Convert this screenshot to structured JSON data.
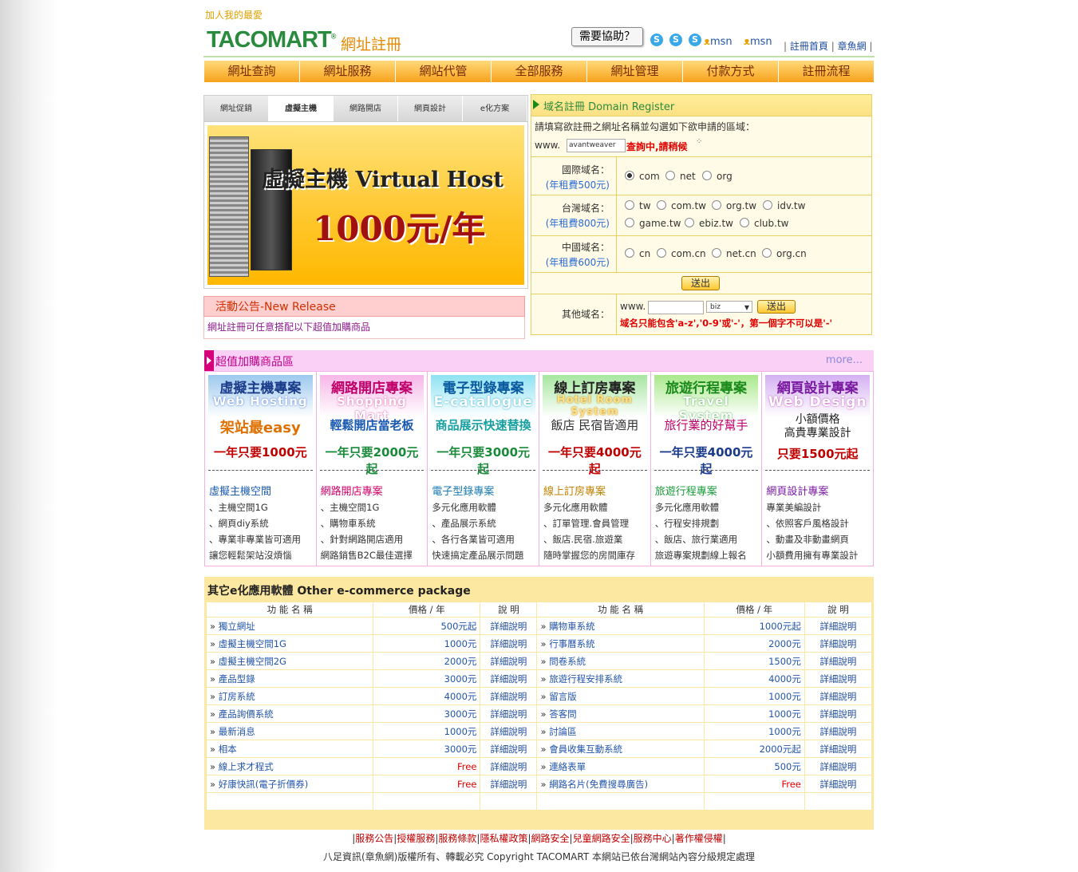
{
  "header": {
    "favorite": "加人我的最愛",
    "logo": "TACOMART",
    "logo_mark": "®",
    "subtitle": "網址註冊",
    "help": "需要協助？",
    "skype_icons": [
      "skype-icon",
      "skype-icon",
      "skype-icon"
    ],
    "msn": "msn",
    "links": [
      "註冊首頁",
      "章魚網"
    ]
  },
  "nav": [
    "網址查詢",
    "網址服務",
    "網站代管",
    "全部服務",
    "網址管理",
    "付款方式",
    "註冊流程"
  ],
  "tabs": [
    "網址促銷",
    "虛擬主機",
    "網路開店",
    "網頁設計",
    "e化方案"
  ],
  "banner": {
    "title": "虛擬主機 Virtual Host",
    "price": "1000元/年"
  },
  "news": {
    "title": "活動公告-New Release",
    "body": "網址註冊可任意搭配以下超值加購商品"
  },
  "domain": {
    "title": "域名註冊 Domain Register",
    "instruction": "請填寫欲註冊之網址名稱並勾選如下欲申請的區域：",
    "www": "www.",
    "value": "avantweaver",
    "status": "查詢中,請稍候",
    "groups": [
      {
        "label": "國際域名：",
        "price": "(年租費500元)",
        "options": [
          "com",
          "net",
          "org"
        ]
      },
      {
        "label": "台灣域名：",
        "price": "(年租費800元)",
        "options": [
          "tw",
          "com.tw",
          "org.tw",
          "idv.tw",
          "game.tw",
          "ebiz.tw",
          "club.tw"
        ]
      },
      {
        "label": "中國域名：",
        "price": "(年租費600元)",
        "options": [
          "cn",
          "com.cn",
          "net.cn",
          "org.cn"
        ]
      }
    ],
    "submit": "送出",
    "other_label": "其他域名：",
    "other_www": "www.",
    "other_select": "biz",
    "other_submit": "送出",
    "rule": "域名只能包含'a-z','0-9'或'-'，第一個字不可以是'-'"
  },
  "valueadd": {
    "title": "超值加購商品區",
    "more": "more...",
    "cols": [
      {
        "a": "虛擬主機專案",
        "b": "Web Hosting",
        "c": "架站最easy",
        "d": "一年只要1000元",
        "title": "虛擬主機空間",
        "items": [
          "、主機空間1G",
          "、網頁diy系統",
          "、專業非專業皆可適用",
          "讓您輕鬆架站沒煩惱"
        ]
      },
      {
        "a": "網路開店專案",
        "b": "Shopping Mart",
        "c": "輕鬆開店當老板",
        "d": "一年只要2000元起",
        "title": "網路開店專案",
        "items": [
          "、主機空間1G",
          "、購物車系統",
          "、針對網路開店適用",
          "網路銷售B2C最佳選擇"
        ]
      },
      {
        "a": "電子型錄專案",
        "b": "E-catalogue",
        "c": "商品展示快速替換",
        "d": "一年只要3000元起",
        "title": "電子型錄專案",
        "items": [
          "多元化應用軟體",
          "、產品展示系統",
          "、各行各業皆可適用",
          "快速搞定產品展示問題"
        ]
      },
      {
        "a": "線上訂房專案",
        "b": "Hotel Room System",
        "c": "飯店 民宿皆適用",
        "d": "一年只要4000元起",
        "title": "線上訂房專案",
        "items": [
          "多元化應用軟體",
          "、訂單管理.會員管理",
          "、飯店.民宿.旅遊業",
          "隨時掌握您的房間庫存"
        ]
      },
      {
        "a": "旅遊行程專案",
        "b": "Travel System",
        "c": "旅行業的好幫手",
        "d": "一年只要4000元起",
        "title": "旅遊行程專案",
        "items": [
          "多元化應用軟體",
          "、行程安排規劃",
          "、飯店、旅行業適用",
          "旅遊專案規劃線上報名"
        ]
      },
      {
        "a": "網頁設計專案",
        "b": "Web Design",
        "c": "小額價格\n高貴專業設計",
        "d": "只要1500元起",
        "title": "網頁設計專案",
        "items": [
          "專業美編設計",
          "、依照客戶風格設計",
          "、動畫及非動畫網頁",
          "小額費用擁有專業設計"
        ]
      }
    ]
  },
  "other": {
    "title": "其它e化應用軟體 Other e-commerce package",
    "headers": [
      "功 能 名 稱",
      "價格 / 年",
      "說 明",
      "功 能 名 稱",
      "價格 / 年",
      "說 明"
    ],
    "detail": "詳細說明",
    "left": [
      [
        "獨立網址",
        "500元起"
      ],
      [
        "虛擬主機空間1G",
        "1000元"
      ],
      [
        "虛擬主機空間2G",
        "2000元"
      ],
      [
        "產品型錄",
        "3000元"
      ],
      [
        "訂房系統",
        "4000元"
      ],
      [
        "產品詢價系統",
        "3000元"
      ],
      [
        "最新消息",
        "1000元"
      ],
      [
        "相本",
        "3000元"
      ],
      [
        "線上求才程式",
        "Free"
      ],
      [
        "好康快訊(電子折價券)",
        "Free"
      ]
    ],
    "right": [
      [
        "購物車系統",
        "1000元起"
      ],
      [
        "行事曆系統",
        "2000元"
      ],
      [
        "問卷系統",
        "1500元"
      ],
      [
        "旅遊行程安排系統",
        "4000元"
      ],
      [
        "留言版",
        "1000元"
      ],
      [
        "答客問",
        "1000元"
      ],
      [
        "討論區",
        "1000元"
      ],
      [
        "會員收集互動系統",
        "2000元起"
      ],
      [
        "連絡表單",
        "500元"
      ],
      [
        "網路名片(免費搜尋廣告)",
        "Free"
      ]
    ]
  },
  "footer": {
    "links": [
      "服務公告",
      "授權服務",
      "服務條款",
      "隱私權政策",
      "網路安全",
      "兒童網路安全",
      "服務中心",
      "著作權侵權"
    ],
    "copyright": "八足資訊(章魚網)版權所有、轉載必究 Copyright TACOMART 本網站已依台灣網站內容分級規定處理"
  },
  "colors": {
    "green": "#2a8a3e",
    "orange": "#f7a21b",
    "pink": "#d6007a",
    "yellow": "#fde8a2"
  }
}
